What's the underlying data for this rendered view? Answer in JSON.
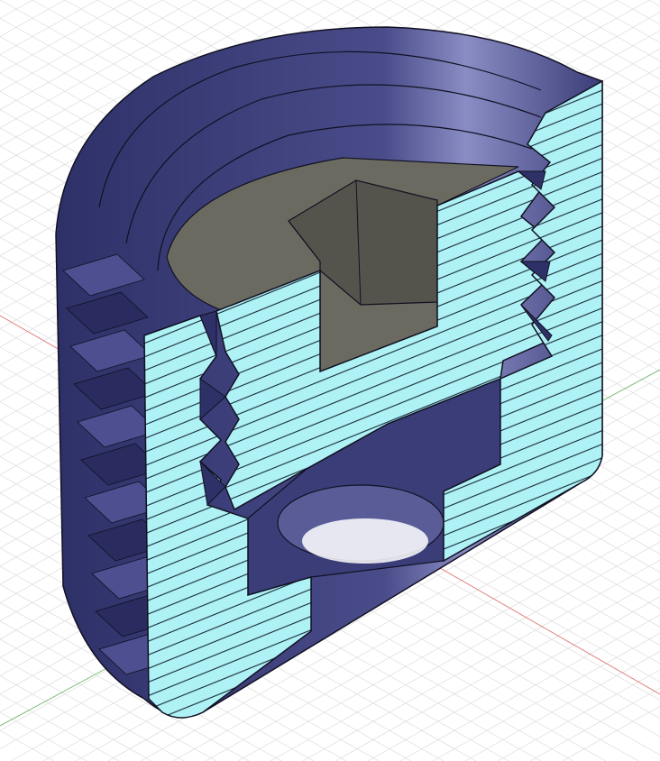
{
  "viewport": {
    "background": "#ffffff",
    "grid_color": "#dcdcdc",
    "x_axis_color": "#e08080",
    "y_axis_color": "#80c080"
  },
  "model": {
    "body_color": "#3b3d78",
    "body_highlight": "#6a6ca8",
    "section_color": "#aef2f5",
    "hatch_color": "#1a2a3a",
    "inner_face_color": "#6b6a60",
    "socket_color": "#55544c",
    "edge_color": "#111122"
  }
}
